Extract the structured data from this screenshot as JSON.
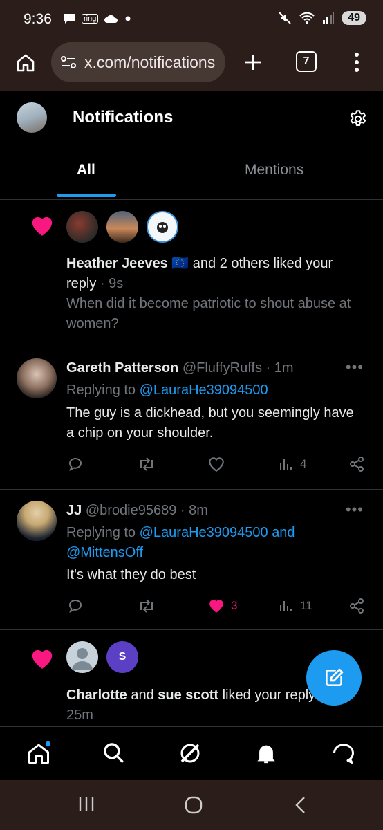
{
  "status_bar": {
    "time": "9:36",
    "ring_label": "ring",
    "battery": "49"
  },
  "browser": {
    "url": "x.com/notifications",
    "tab_count": "7"
  },
  "header": {
    "title": "Notifications",
    "tabs": [
      "All",
      "Mentions"
    ]
  },
  "notifications": [
    {
      "type": "like",
      "actor": "Heather Jeeves",
      "flag": "🇪🇺",
      "rest": " and 2 others liked your reply",
      "time": " · 9s",
      "quote": "When did it become patriotic to shout abuse at women?"
    },
    {
      "type": "reply",
      "name": "Gareth Patterson",
      "handle": "@FluffyRuffs",
      "time": " · 1m",
      "replying_prefix": "Replying to ",
      "replying_to": "@LauraHe39094500",
      "text": "The guy is a dickhead, but you seemingly have a chip on your shoulder.",
      "likes": "",
      "views": "4"
    },
    {
      "type": "reply",
      "name": "JJ",
      "handle": "@brodie95689",
      "time": " · 8m",
      "replying_prefix": "Replying to ",
      "replying_to": "@LauraHe39094500 and @MittensOff",
      "text": "It's what they do best",
      "likes": "3",
      "views": "11"
    },
    {
      "type": "like",
      "actor": "Charlotte",
      "and": " and ",
      "actor2": "sue scott",
      "rest": " liked your reply",
      "avatar_letter": "S",
      "time": "25m"
    }
  ],
  "colors": {
    "accent": "#1d9bf0",
    "like": "#f91880",
    "chrome": "#2b1d1a"
  }
}
